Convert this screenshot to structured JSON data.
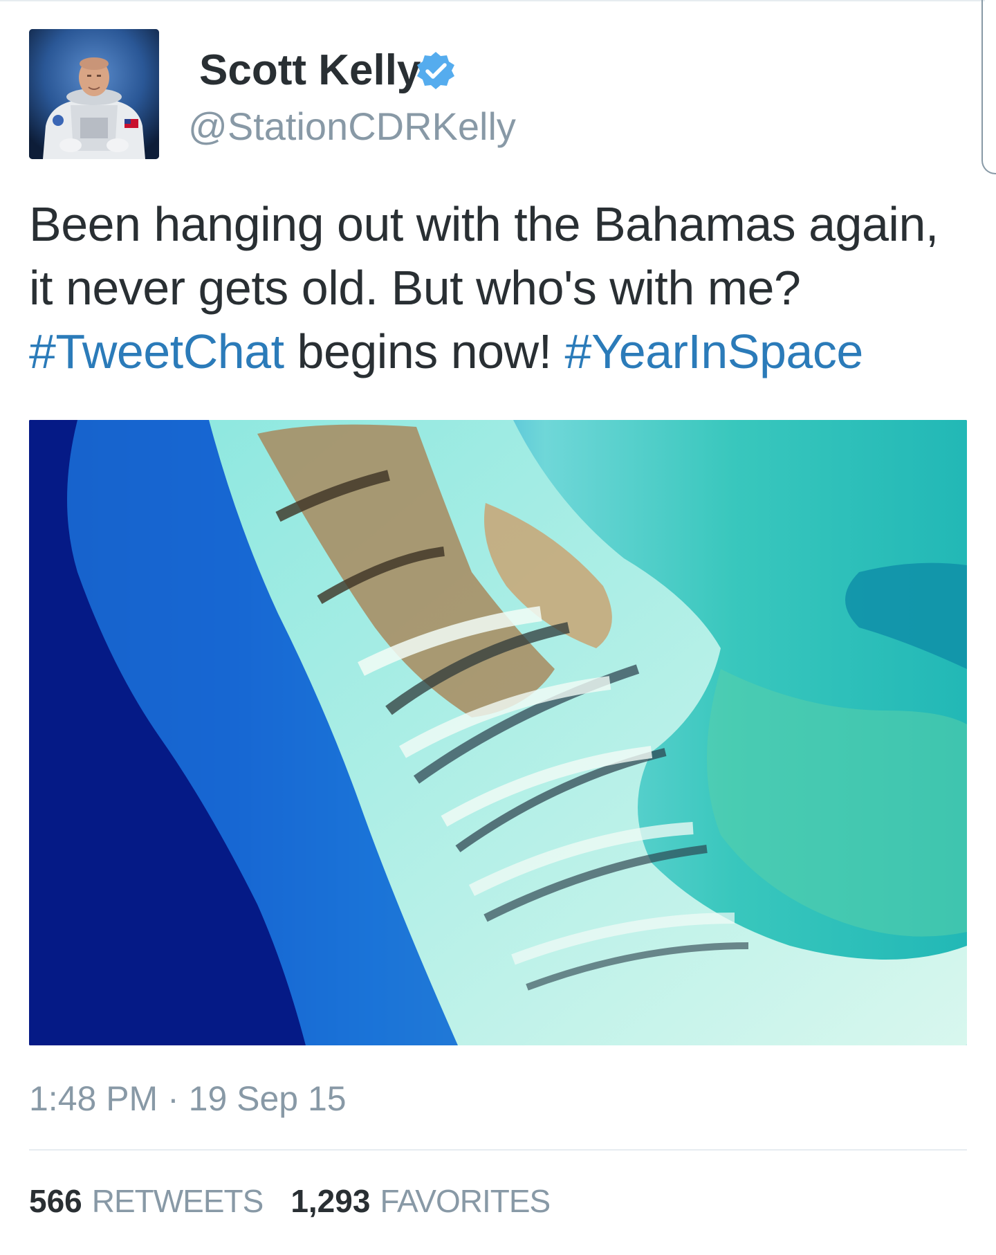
{
  "tweet": {
    "author": {
      "name": "Scott Kelly",
      "handle": "@StationCDRKelly",
      "verified": true
    },
    "text_lines": [
      "Been hanging out with the Bahamas again,",
      "it never gets old. But who's with me?"
    ],
    "hashtag_1": "#TweetChat",
    "text_middle": " begins now! ",
    "hashtag_2": "#YearInSpace",
    "timestamp": "1:48 PM · 19 Sep 15",
    "stats": {
      "retweets_count": "566",
      "retweets_label": "RETWEETS",
      "favorites_count": "1,293",
      "favorites_label": "FAVORITES"
    }
  },
  "colors": {
    "text": "#292f33",
    "secondary": "#8899a6",
    "link": "#2b7bb9",
    "verified": "#55acee"
  },
  "icons": {
    "verified": "verified-badge-icon"
  }
}
